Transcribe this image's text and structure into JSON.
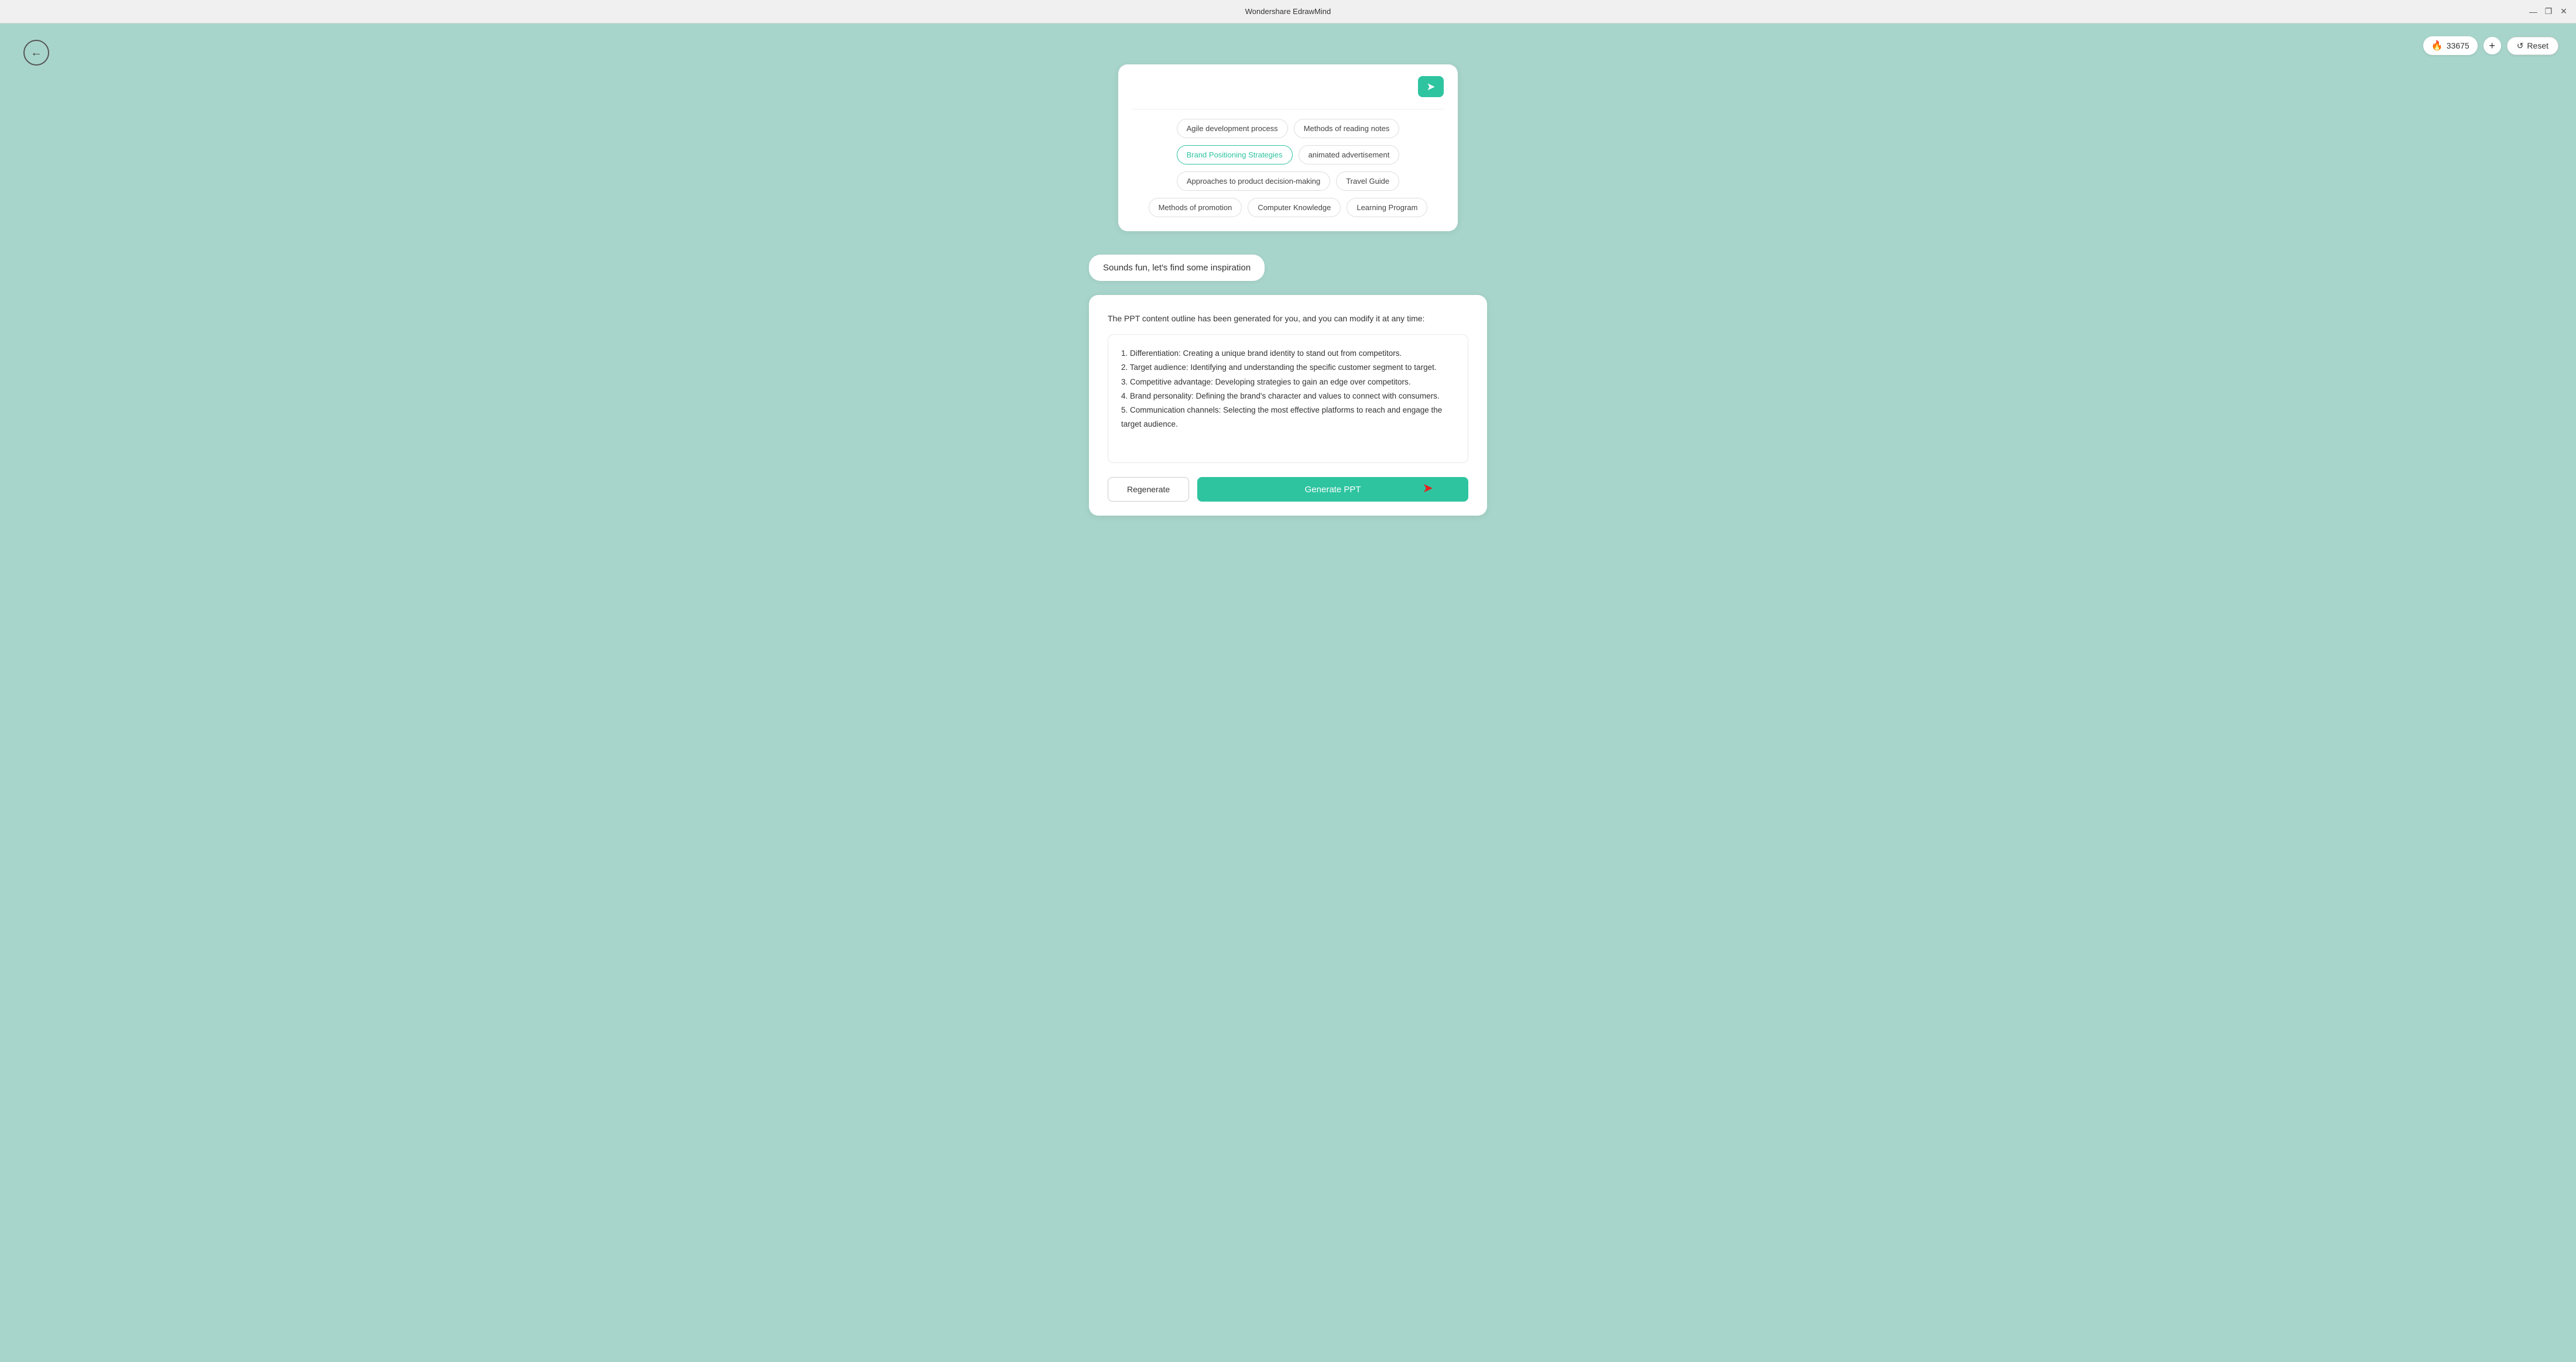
{
  "titlebar": {
    "title": "Wondershare EdrawMind",
    "minimize": "—",
    "maximize": "❐",
    "close": "✕"
  },
  "toolbar": {
    "credits_icon": "🔥",
    "credits_value": "33675",
    "add_label": "+",
    "reset_icon": "↺",
    "reset_label": "Reset"
  },
  "back_button": {
    "icon": "←"
  },
  "chips_panel": {
    "input_placeholder": "",
    "send_icon": "➤",
    "rows": [
      [
        {
          "label": "Agile development process",
          "active": false
        },
        {
          "label": "Methods of reading notes",
          "active": false
        }
      ],
      [
        {
          "label": "Brand Positioning Strategies",
          "active": true
        },
        {
          "label": "animated advertisement",
          "active": false
        }
      ],
      [
        {
          "label": "Approaches to product decision-making",
          "active": false
        },
        {
          "label": "Travel Guide",
          "active": false
        }
      ],
      [
        {
          "label": "Methods of promotion",
          "active": false
        },
        {
          "label": "Computer Knowledge",
          "active": false
        },
        {
          "label": "Learning Program",
          "active": false
        }
      ]
    ]
  },
  "user_message": {
    "text": "Sounds fun, let's find some inspiration"
  },
  "result_panel": {
    "intro": "The PPT content outline has been generated for you, and you can modify it at any time:",
    "content": "1. Differentiation: Creating a unique brand identity to stand out from competitors.\n2. Target audience: Identifying and understanding the specific customer segment to target.\n3. Competitive advantage: Developing strategies to gain an edge over competitors.\n4. Brand personality: Defining the brand's character and values to connect with consumers.\n5. Communication channels: Selecting the most effective platforms to reach and engage the target audience.",
    "regenerate_label": "Regenerate",
    "generate_ppt_label": "Generate PPT"
  }
}
